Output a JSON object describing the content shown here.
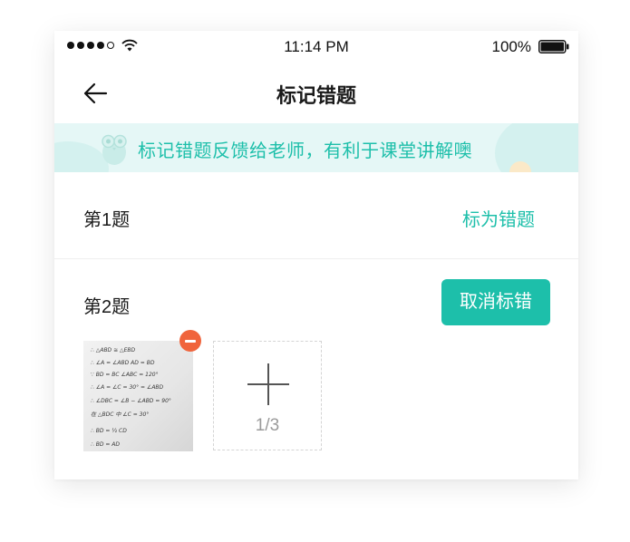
{
  "status_bar": {
    "time": "11:14 PM",
    "battery": "100%"
  },
  "nav": {
    "title": "标记错题"
  },
  "banner": {
    "text": "标记错题反馈给老师，有利于课堂讲解噢"
  },
  "questions": [
    {
      "label": "第1题",
      "action_label": "标为错题"
    },
    {
      "label": "第2题",
      "action_label": "取消标错"
    }
  ],
  "photos": {
    "counter": "1/3"
  },
  "handwriting": [
    "∴ △ABD ≅ △EBD",
    "∴ ∠A = ∠ABD   AD = BD",
    "∵ BD = BC   ∠ABC = 120°",
    "∴ ∠A = ∠C = 30° = ∠ABD",
    "∴ ∠DBC = ∠B − ∠ABD = 90°",
    "在 △BDC 中  ∠C = 30°",
    "∴ BD = ½ CD",
    "∴ BD = AD"
  ],
  "colors": {
    "accent": "#1dbfaa",
    "banner_bg": "#e5f7f6",
    "remove_badge": "#f0643c"
  }
}
